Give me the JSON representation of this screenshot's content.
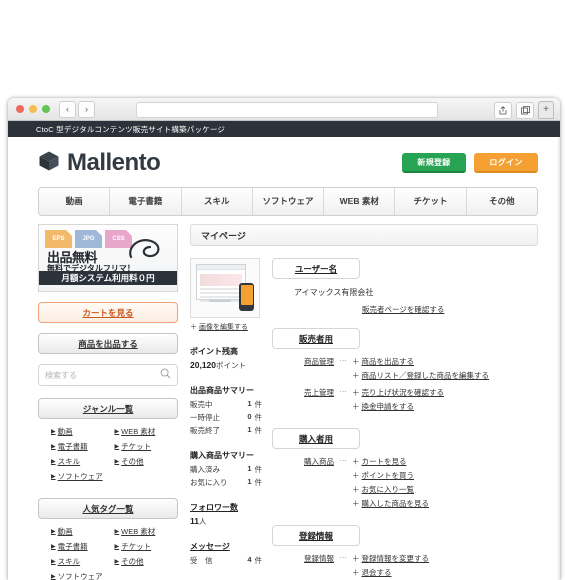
{
  "browser": {
    "traffic_lights": [
      "close-red",
      "minimize-yellow",
      "maximize-green"
    ],
    "back_label": "‹",
    "forward_label": "›",
    "url_value": "",
    "url_placeholder": "",
    "share_icon": "share-icon",
    "tabs_icon": "tabs-icon",
    "newtab_label": "+"
  },
  "site": {
    "topbar_text": "CtoC 型デジタルコンテンツ販売サイト構築パッケージ",
    "logo_text": "Mallento",
    "logo_icon": "box-logo-icon",
    "register_label": "新規登録",
    "login_label": "ログイン",
    "register_color": "#27a354",
    "login_color": "#f5a033",
    "nav_tabs": [
      {
        "label": "動画"
      },
      {
        "label": "電子書籍"
      },
      {
        "label": "スキル"
      },
      {
        "label": "ソフトウェア"
      },
      {
        "label": "WEB 素材"
      },
      {
        "label": "チケット"
      },
      {
        "label": "その他"
      }
    ]
  },
  "sidebar": {
    "banner": {
      "files": [
        {
          "label": "EPS",
          "color": "#f3b96b"
        },
        {
          "label": "JPG",
          "color": "#9fb8d8"
        },
        {
          "label": "CSS",
          "color": "#e9a6cb"
        }
      ],
      "title": "出品無料",
      "subtitle": "無料でデジタルフリマ！",
      "bar_text": "月額システム利用料０円"
    },
    "cart_button": "カートを見る",
    "sell_button": "商品を出品する",
    "search_placeholder": "検索する",
    "search_value": "",
    "genre_panel": {
      "title": "ジャンル一覧",
      "left_links": [
        {
          "label": "動画"
        },
        {
          "label": "電子書籍"
        },
        {
          "label": "スキル"
        },
        {
          "label": "ソフトウェア"
        }
      ],
      "right_links": [
        {
          "label": "WEB 素材"
        },
        {
          "label": "チケット"
        },
        {
          "label": "その他"
        }
      ]
    },
    "tag_panel": {
      "title": "人気タグ一覧",
      "left_links": [
        {
          "label": "動画"
        },
        {
          "label": "電子書籍"
        },
        {
          "label": "スキル"
        },
        {
          "label": "ソフトウェア"
        }
      ],
      "right_links": [
        {
          "label": "WEB 素材"
        },
        {
          "label": "チケット"
        },
        {
          "label": "その他"
        }
      ]
    }
  },
  "main": {
    "page_title": "マイページ",
    "profile": {
      "image_alt": "profile-thumbnail",
      "edit_image_prefix": "＋ ",
      "edit_image_label": "画像を編集する"
    },
    "user_section": {
      "title": "ユーザー名",
      "company": "アイマックス有限会社",
      "verify_link": "販売者ページを確認する"
    },
    "seller_section": {
      "title": "販売者用",
      "rows": [
        {
          "label": "商品管理",
          "dots": "⋯",
          "items": [
            {
              "label": "商品を出品する"
            },
            {
              "label": "商品リスト／登録した商品を編集する"
            }
          ]
        },
        {
          "label": "売上管理",
          "dots": "⋯",
          "items": [
            {
              "label": "売り上げ状況を確認する"
            },
            {
              "label": "換金申請をする"
            }
          ]
        }
      ]
    },
    "buyer_section": {
      "title": "購入者用",
      "rows": [
        {
          "label": "購入商品",
          "dots": "⋯",
          "items": [
            {
              "label": "カートを見る"
            },
            {
              "label": "ポイントを買う"
            },
            {
              "label": "お気に入り一覧"
            },
            {
              "label": "購入した商品を見る"
            }
          ]
        }
      ]
    },
    "registration_section": {
      "title": "登録情報",
      "rows": [
        {
          "label": "登録情報",
          "dots": "⋯",
          "items": [
            {
              "label": "登録情報を変更する"
            },
            {
              "label": "退会する"
            }
          ]
        }
      ]
    },
    "stats": {
      "points": {
        "title": "ポイント残高",
        "value": "20,120",
        "unit": "ポイント"
      },
      "listing_summary": {
        "title": "出品商品サマリー",
        "rows": [
          {
            "label": "販売中",
            "value": "1",
            "unit": "件"
          },
          {
            "label": "一時停止",
            "value": "0",
            "unit": "件"
          },
          {
            "label": "販売終了",
            "value": "1",
            "unit": "件"
          }
        ]
      },
      "purchase_summary": {
        "title": "購入商品サマリー",
        "rows": [
          {
            "label": "購入済み",
            "value": "1",
            "unit": "件"
          },
          {
            "label": "お気に入り",
            "value": "1",
            "unit": "件"
          }
        ]
      },
      "followers": {
        "title": "フォロワー数",
        "value": "11",
        "unit": "人"
      },
      "messages": {
        "title": "メッセージ",
        "rows": [
          {
            "label": "受　信",
            "value": "4",
            "unit": "件"
          }
        ]
      }
    }
  }
}
